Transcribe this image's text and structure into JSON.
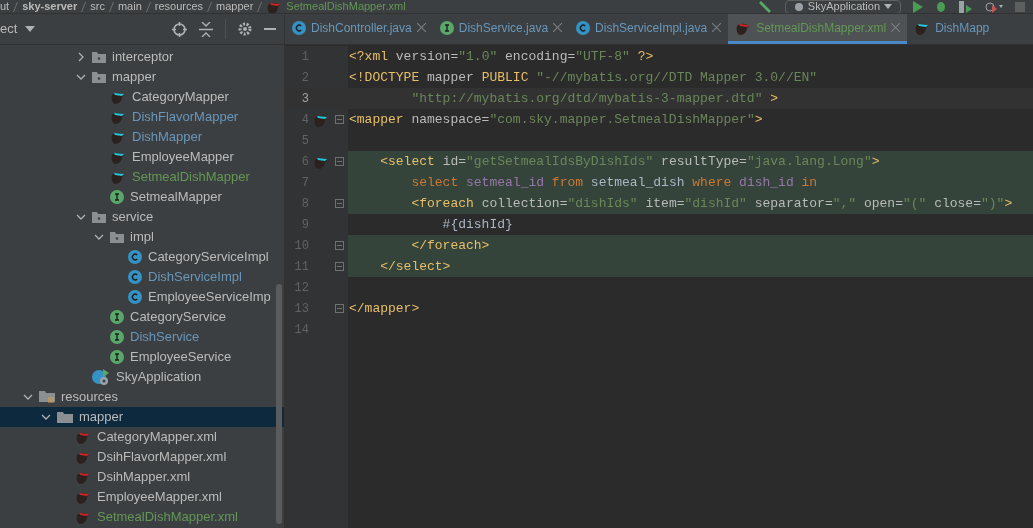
{
  "breadcrumb": [
    "ut",
    "sky-server",
    "src",
    "main",
    "resources",
    "mapper",
    "SetmealDishMapper.xml"
  ],
  "run_config": {
    "label": "SkyApplication"
  },
  "project_panel": {
    "title": "ect"
  },
  "package_tree": [
    {
      "label": "interceptor",
      "kind": "folder",
      "expanded": false,
      "color": "#bbbbbb",
      "selected": false
    },
    {
      "label": "mapper",
      "kind": "folder",
      "expanded": true,
      "color": "#bbbbbb",
      "selected": false,
      "children": [
        {
          "label": "CategoryMapper",
          "kind": "mapper",
          "color": "#bbbbbb",
          "selected": false
        },
        {
          "label": "DishFlavorMapper",
          "kind": "mapper",
          "color": "#6897bb",
          "selected": false
        },
        {
          "label": "DishMapper",
          "kind": "mapper",
          "color": "#6897bb",
          "selected": false
        },
        {
          "label": "EmployeeMapper",
          "kind": "mapper",
          "color": "#bbbbbb",
          "selected": false
        },
        {
          "label": "SetmealDishMapper",
          "kind": "mapper",
          "color": "#629755",
          "selected": false
        },
        {
          "label": "SetmealMapper",
          "kind": "interface",
          "color": "#bbbbbb",
          "selected": false
        }
      ]
    },
    {
      "label": "service",
      "kind": "folder",
      "expanded": true,
      "color": "#bbbbbb",
      "selected": false,
      "children": [
        {
          "label": "impl",
          "kind": "folder",
          "expanded": true,
          "color": "#bbbbbb",
          "selected": false,
          "children": [
            {
              "label": "CategoryServiceImpl",
              "kind": "class",
              "color": "#bbbbbb",
              "selected": false
            },
            {
              "label": "DishServiceImpl",
              "kind": "class",
              "color": "#6897bb",
              "selected": false
            },
            {
              "label": "EmployeeServiceImp",
              "kind": "class",
              "color": "#bbbbbb",
              "selected": false
            }
          ]
        },
        {
          "label": "CategoryService",
          "kind": "interface",
          "color": "#bbbbbb",
          "selected": false
        },
        {
          "label": "DishService",
          "kind": "interface",
          "color": "#6897bb",
          "selected": false
        },
        {
          "label": "EmployeeService",
          "kind": "interface",
          "color": "#bbbbbb",
          "selected": false
        }
      ]
    },
    {
      "label": "SkyApplication",
      "kind": "app",
      "color": "#bbbbbb",
      "selected": false
    }
  ],
  "resources_tree": [
    {
      "label": "resources",
      "kind": "resfolder",
      "expanded": true,
      "color": "#bbbbbb",
      "selected": false,
      "children": [
        {
          "label": "mapper",
          "kind": "plainfolder",
          "expanded": true,
          "color": "#bbbbbb",
          "selected": true,
          "children": [
            {
              "label": "CategoryMapper.xml",
              "kind": "xml",
              "color": "#bbbbbb",
              "selected": false
            },
            {
              "label": "DsihFlavorMapper.xml",
              "kind": "xml",
              "color": "#bbbbbb",
              "selected": false
            },
            {
              "label": "DsihMapper.xml",
              "kind": "xml",
              "color": "#bbbbbb",
              "selected": false
            },
            {
              "label": "EmployeeMapper.xml",
              "kind": "xml",
              "color": "#bbbbbb",
              "selected": false
            },
            {
              "label": "SetmealDishMapper.xml",
              "kind": "xml",
              "color": "#629755",
              "selected": false
            }
          ]
        }
      ]
    }
  ],
  "tabs": [
    {
      "label": "DishController.java",
      "kind": "class",
      "color": "#6897bb",
      "selected": false,
      "closable": true
    },
    {
      "label": "DishService.java",
      "kind": "interface",
      "color": "#6897bb",
      "selected": false,
      "closable": true
    },
    {
      "label": "DishServiceImpl.java",
      "kind": "class",
      "color": "#6897bb",
      "selected": false,
      "closable": true
    },
    {
      "label": "SetmealDishMapper.xml",
      "kind": "xml",
      "color": "#629755",
      "selected": true,
      "closable": true
    },
    {
      "label": "DishMapp",
      "kind": "mapper",
      "color": "#6897bb",
      "selected": false,
      "closable": false
    }
  ],
  "editor": {
    "lines": [
      {
        "number": "1",
        "current": false,
        "changed": false,
        "gutter_icon": false,
        "fold": false,
        "segments": [
          {
            "kind": "tag",
            "text": "<?xml"
          },
          {
            "kind": "attr",
            "text": " version="
          },
          {
            "kind": "value",
            "text": "\"1.0\""
          },
          {
            "kind": "attr",
            "text": " encoding="
          },
          {
            "kind": "value",
            "text": "\"UTF-8\""
          },
          {
            "kind": "tag",
            "text": " ?>"
          }
        ]
      },
      {
        "number": "2",
        "current": false,
        "changed": false,
        "gutter_icon": false,
        "fold": false,
        "segments": [
          {
            "kind": "tag",
            "text": "<!DOCTYPE"
          },
          {
            "kind": "attr",
            "text": " mapper"
          },
          {
            "kind": "tag",
            "text": " PUBLIC"
          },
          {
            "kind": "value",
            "text": " \"-//mybatis.org//DTD Mapper 3.0//EN\""
          }
        ]
      },
      {
        "number": "3",
        "current": true,
        "changed": false,
        "gutter_icon": false,
        "fold": false,
        "segments": [
          {
            "kind": "value",
            "text": "        \"http://mybatis.org/dtd/mybatis-3-mapper.dtd\""
          },
          {
            "kind": "tag",
            "text": " >"
          }
        ]
      },
      {
        "number": "4",
        "current": false,
        "changed": false,
        "gutter_icon": true,
        "fold": true,
        "segments": [
          {
            "kind": "tag",
            "text": "<mapper"
          },
          {
            "kind": "attr",
            "text": " namespace="
          },
          {
            "kind": "value",
            "text": "\"com.sky.mapper.SetmealDishMapper\""
          },
          {
            "kind": "tag",
            "text": ">"
          }
        ]
      },
      {
        "number": "5",
        "current": false,
        "changed": false,
        "gutter_icon": false,
        "fold": false
      },
      {
        "number": "6",
        "current": false,
        "changed": true,
        "gutter_icon": true,
        "fold": true,
        "segments": [
          {
            "kind": "tag",
            "text": "    <select"
          },
          {
            "kind": "attr",
            "text": " id="
          },
          {
            "kind": "value",
            "text": "\"getSetmealIdsByDishIds\""
          },
          {
            "kind": "attr",
            "text": " resultType="
          },
          {
            "kind": "value",
            "text": "\"java.lang.Long\""
          },
          {
            "kind": "tag",
            "text": ">"
          }
        ]
      },
      {
        "number": "7",
        "current": false,
        "changed": true,
        "gutter_icon": false,
        "fold": false,
        "segments": [
          {
            "kind": "kw",
            "text": "        select"
          },
          {
            "kind": "field",
            "text": " setmeal_id"
          },
          {
            "kind": "kw",
            "text": " from"
          },
          {
            "kind": "plain",
            "text": " setmeal_dish"
          },
          {
            "kind": "kw",
            "text": " where"
          },
          {
            "kind": "field",
            "text": " dish_id"
          },
          {
            "kind": "kw",
            "text": " in"
          }
        ]
      },
      {
        "number": "8",
        "current": false,
        "changed": true,
        "gutter_icon": false,
        "fold": true,
        "segments": [
          {
            "kind": "tag",
            "text": "        <foreach"
          },
          {
            "kind": "attr",
            "text": " collection="
          },
          {
            "kind": "value",
            "text": "\"dishIds\""
          },
          {
            "kind": "attr",
            "text": " item="
          },
          {
            "kind": "value",
            "text": "\"dishId\""
          },
          {
            "kind": "attr",
            "text": " separator="
          },
          {
            "kind": "value",
            "text": "\",\""
          },
          {
            "kind": "attr",
            "text": " open="
          },
          {
            "kind": "value",
            "text": "\"(\""
          },
          {
            "kind": "attr",
            "text": " close="
          },
          {
            "kind": "value",
            "text": "\")\""
          },
          {
            "kind": "tag",
            "text": ">"
          }
        ]
      },
      {
        "number": "9",
        "current": false,
        "changed": false,
        "gutter_icon": false,
        "fold": false,
        "segments": [
          {
            "kind": "plain",
            "text": "            #{dishId}"
          }
        ]
      },
      {
        "number": "10",
        "current": false,
        "changed": true,
        "gutter_icon": false,
        "fold": true,
        "segments": [
          {
            "kind": "tag",
            "text": "        </foreach>"
          }
        ]
      },
      {
        "number": "11",
        "current": false,
        "changed": true,
        "gutter_icon": false,
        "fold": true,
        "segments": [
          {
            "kind": "tag",
            "text": "    </select>"
          }
        ]
      },
      {
        "number": "12",
        "current": false,
        "changed": false,
        "gutter_icon": false,
        "fold": false
      },
      {
        "number": "13",
        "current": false,
        "changed": false,
        "gutter_icon": false,
        "fold": true,
        "segments": [
          {
            "kind": "tag",
            "text": "</mapper>"
          }
        ]
      },
      {
        "number": "14",
        "current": false,
        "changed": false,
        "gutter_icon": false,
        "fold": false
      }
    ]
  }
}
